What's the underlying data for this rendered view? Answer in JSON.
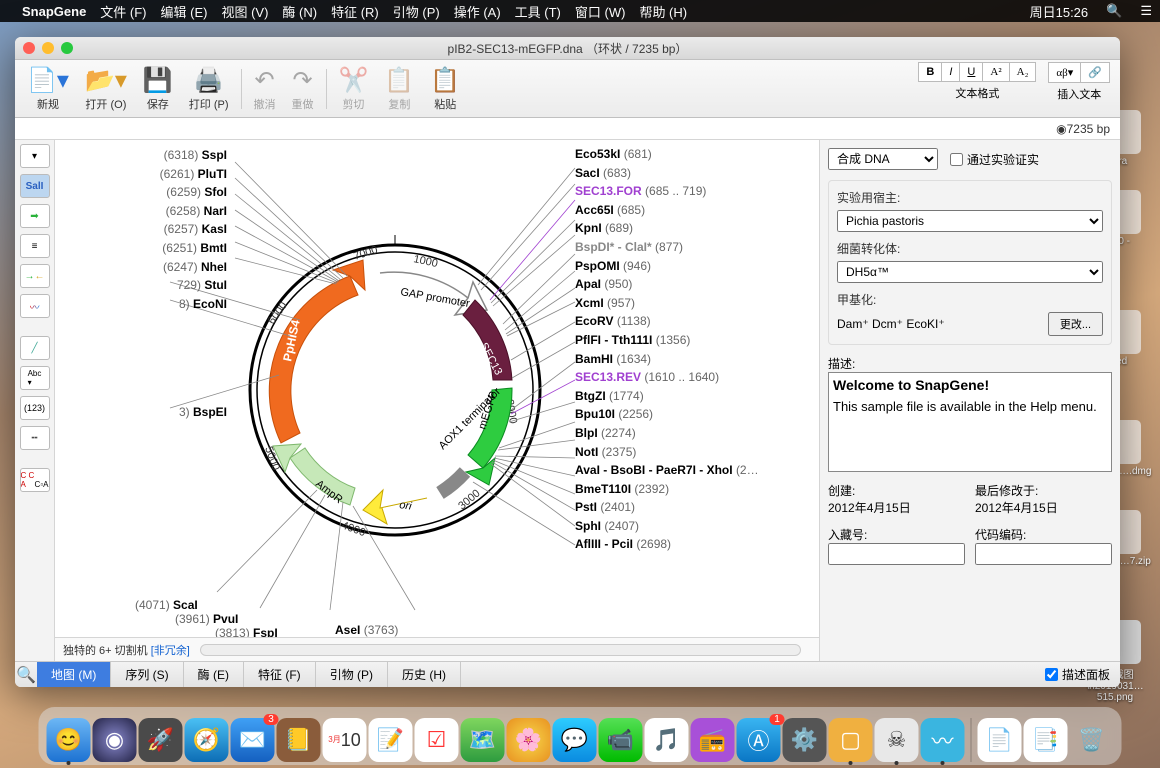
{
  "menubar": {
    "app": "SnapGene",
    "items": [
      "文件 (F)",
      "编辑 (E)",
      "视图 (V)",
      "酶 (N)",
      "特征 (R)",
      "引物 (P)",
      "操作 (A)",
      "工具 (T)",
      "窗口 (W)",
      "帮助 (H)"
    ],
    "clock": "周日15:26"
  },
  "window": {
    "title": "pIB2-SEC13-mEGFP.dna （环状 / 7235 bp）",
    "bp_status": "7235 bp"
  },
  "toolbar": {
    "new": "新规",
    "open": "打开 (O)",
    "save": "保存",
    "print": "打印 (P)",
    "undo": "撤消",
    "redo": "重做",
    "cut": "剪切",
    "copy": "复制",
    "paste": "粘贴",
    "fmtlabel": "文本格式",
    "insertlabel": "插入文本"
  },
  "tabs": {
    "map": "地图 (M)",
    "seq": "序列 (S)",
    "enz": "酶 (E)",
    "feat": "特征 (F)",
    "prim": "引物 (P)",
    "hist": "历史 (H)",
    "desc_panel": "描述面板"
  },
  "subtabs": {
    "label": "独特的 6+ 切割机",
    "extra": "[非冗余]"
  },
  "side": {
    "topselect": "合成 DNA",
    "verified": "通过实验证实",
    "host_label": "实验用宿主:",
    "host_value": "Pichia pastoris",
    "transform_label": "细菌转化体:",
    "transform_value": "DH5α™",
    "methyl_label": "甲基化:",
    "methyl_value": "Dam⁺  Dcm⁺  EcoKI⁺",
    "change": "更改...",
    "desc_label": "描述:",
    "desc_heading": "Welcome to SnapGene!",
    "desc_body": "This sample file is available in the Help menu.",
    "created_label": "创建:",
    "created_value": "2012年4月15日",
    "modified_label": "最后修改于:",
    "modified_value": "2012年4月15日",
    "accession_label": "入藏号:",
    "code_label": "代码编码:"
  },
  "enzymes_right": [
    {
      "n": "Eco53kI",
      "p": "(681)"
    },
    {
      "n": "SacI",
      "p": "(683)"
    },
    {
      "n": "SEC13.FOR",
      "p": "(685 .. 719)",
      "cls": "prim"
    },
    {
      "n": "Acc65I",
      "p": "(685)"
    },
    {
      "n": "KpnI",
      "p": "(689)"
    },
    {
      "n": "BspDI* - ClaI*",
      "p": "(877)",
      "cls": "dim"
    },
    {
      "n": "PspOMI",
      "p": "(946)"
    },
    {
      "n": "ApaI",
      "p": "(950)"
    },
    {
      "n": "XcmI",
      "p": "(957)"
    },
    {
      "n": "EcoRV",
      "p": "(1138)"
    },
    {
      "n": "PflFI - Tth111I",
      "p": "(1356)"
    },
    {
      "n": "BamHI",
      "p": "(1634)"
    },
    {
      "n": "SEC13.REV",
      "p": "(1610 .. 1640)",
      "cls": "prim"
    },
    {
      "n": "BtgZI",
      "p": "(1774)"
    },
    {
      "n": "Bpu10I",
      "p": "(2256)"
    },
    {
      "n": "BlpI",
      "p": "(2274)"
    },
    {
      "n": "NotI",
      "p": "(2375)"
    },
    {
      "n": "AvaI - BsoBI - PaeR7I - XhoI",
      "p": "(2…"
    },
    {
      "n": "BmeT110I",
      "p": "(2392)"
    },
    {
      "n": "PstI",
      "p": "(2401)"
    },
    {
      "n": "SphI",
      "p": "(2407)"
    },
    {
      "n": "AflIII - PciI",
      "p": "(2698)"
    }
  ],
  "enzymes_left": [
    {
      "p": "(6318)",
      "n": "SspI"
    },
    {
      "p": "(6261)",
      "n": "PluTI"
    },
    {
      "p": "(6259)",
      "n": "SfoI"
    },
    {
      "p": "(6258)",
      "n": "NarI"
    },
    {
      "p": "(6257)",
      "n": "KasI"
    },
    {
      "p": "(6251)",
      "n": "BmtI"
    },
    {
      "p": "(6247)",
      "n": "NheI"
    },
    {
      "p": "729)",
      "n": "StuI"
    },
    {
      "p": "8)",
      "n": "EcoNI"
    },
    {
      "p": "3)",
      "n": "BspEI",
      "gap": true
    }
  ],
  "enzymes_bottom": [
    {
      "p": "(4071)",
      "n": "ScaI"
    },
    {
      "p": "(3961)",
      "n": "PvuI"
    },
    {
      "p": "(3813)",
      "n": "FspI"
    },
    {
      "n": "AseI",
      "p": "(3763)"
    }
  ],
  "features": {
    "gap": "GAP promoter",
    "sec13": "SEC13",
    "megfp": "mEGFP",
    "aox1": "AOX1 terminator",
    "ori": "ori",
    "ampr": "AmpR",
    "pphis4": "PpHIS4"
  },
  "ticks": [
    "1000",
    "2000",
    "3000",
    "4000",
    "5000",
    "6000",
    "7000"
  ],
  "dock_badges": {
    "mail": "3",
    "app": "1"
  },
  "desktop": {
    "i1": "…era",
    "i2": "…6.0 -",
    "i3": "…red",
    "i4": "…3.1.1\\n….dmg",
    "i5": "…3.1.1\\n…7.zip",
    "i6": "TIM截图\\n2019031…515.png"
  }
}
